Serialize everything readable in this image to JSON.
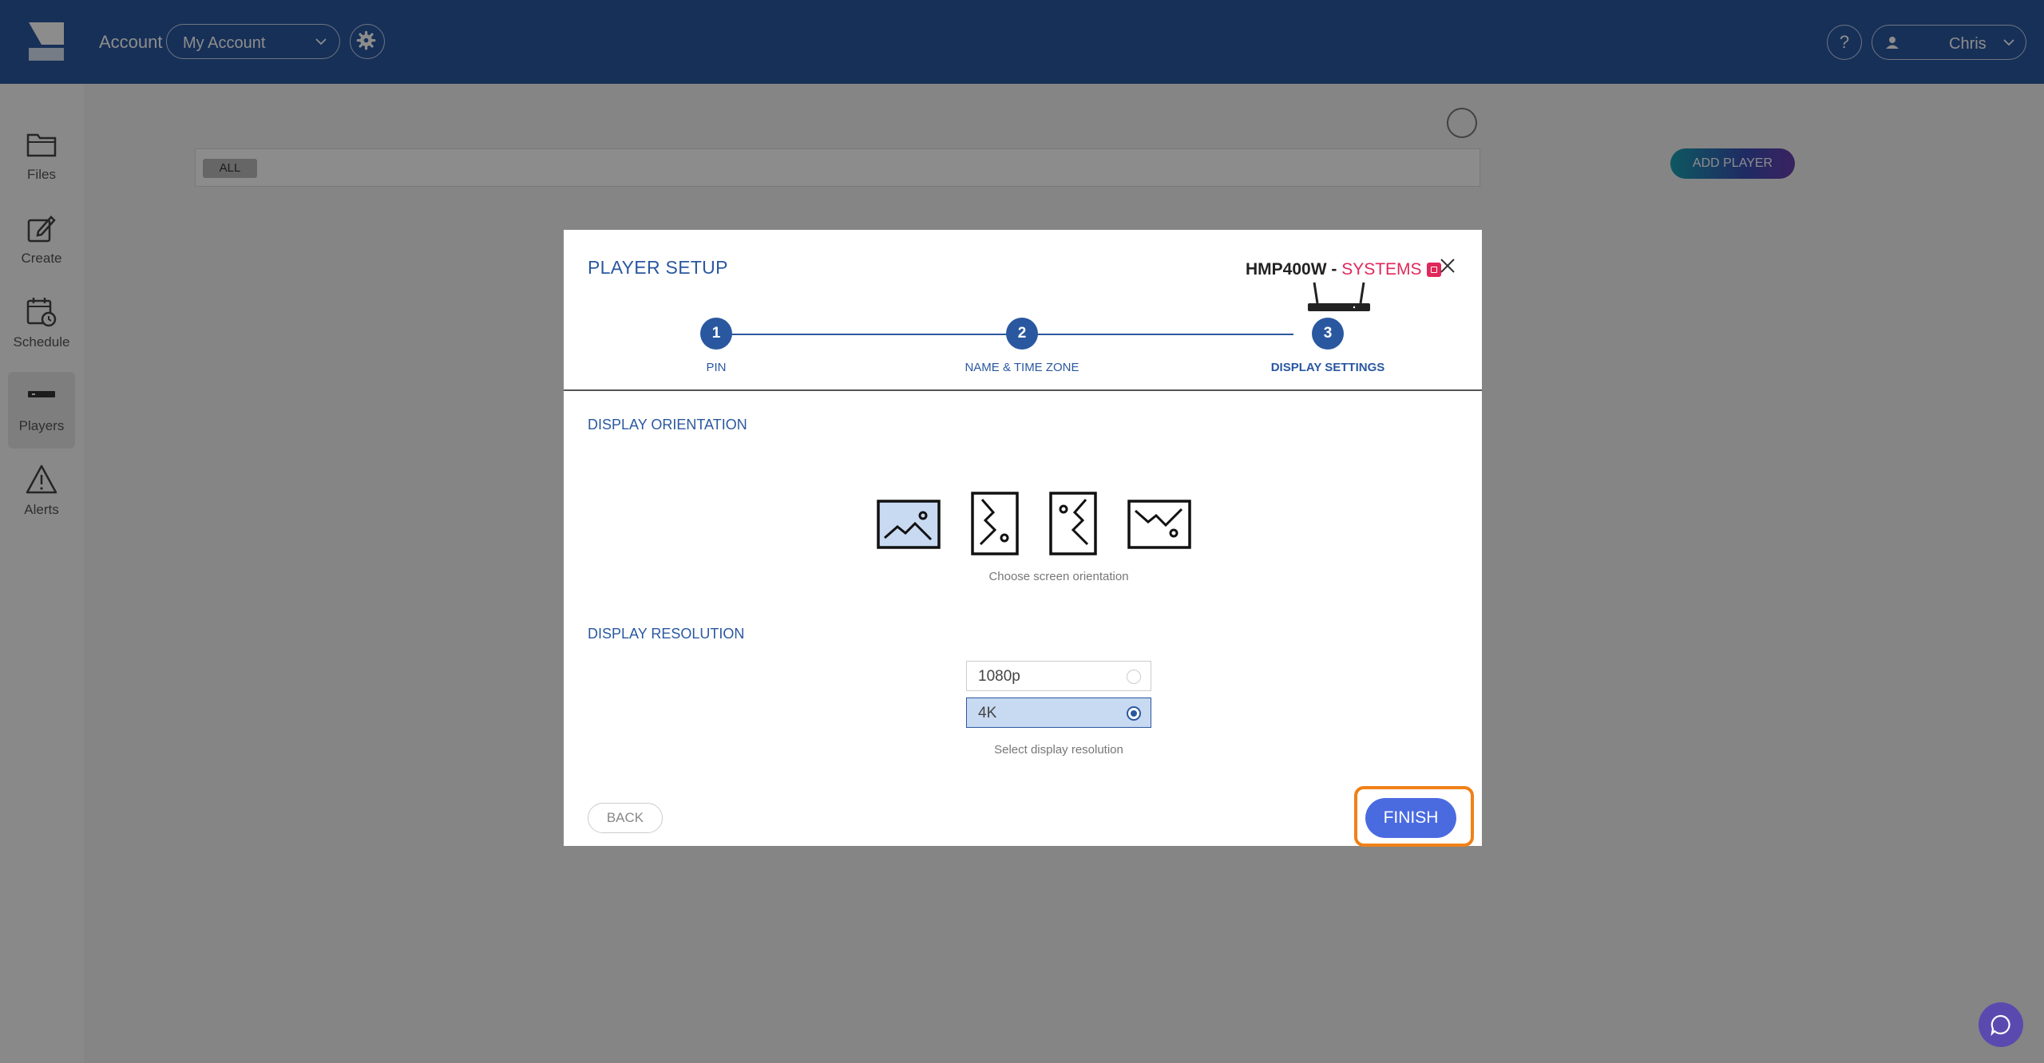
{
  "header": {
    "account_label": "Account",
    "account_select_value": "My Account",
    "help_label": "?",
    "user_name": "Chris"
  },
  "sidebar": {
    "items": [
      {
        "label": "Files",
        "icon": "folder-icon"
      },
      {
        "label": "Create",
        "icon": "edit-icon"
      },
      {
        "label": "Schedule",
        "icon": "calendar-clock-icon"
      },
      {
        "label": "Players",
        "icon": "player-device-icon",
        "active": true
      },
      {
        "label": "Alerts",
        "icon": "warning-icon"
      }
    ]
  },
  "main": {
    "filter_chip": "ALL",
    "add_player_label": "ADD PLAYER"
  },
  "modal": {
    "title": "PLAYER SETUP",
    "device_model": "HMP400W - ",
    "device_tag": "SYSTEMS",
    "steps": [
      {
        "number": "1",
        "label": "PIN"
      },
      {
        "number": "2",
        "label": "NAME & TIME ZONE"
      },
      {
        "number": "3",
        "label": "DISPLAY SETTINGS",
        "current": true
      }
    ],
    "orientation": {
      "heading": "DISPLAY ORIENTATION",
      "options": [
        "landscape",
        "portrait-right",
        "portrait-left",
        "landscape-flipped"
      ],
      "selected": "landscape",
      "hint": "Choose screen orientation"
    },
    "resolution": {
      "heading": "DISPLAY RESOLUTION",
      "options": [
        {
          "label": "1080p",
          "selected": false
        },
        {
          "label": "4K",
          "selected": true
        }
      ],
      "hint": "Select display resolution"
    },
    "back_label": "BACK",
    "finish_label": "FINISH"
  },
  "colors": {
    "brand_blue": "#2a58a0",
    "accent_pink": "#e0285a",
    "highlight_orange": "#f08018",
    "finish_blue": "#4a6be0"
  }
}
